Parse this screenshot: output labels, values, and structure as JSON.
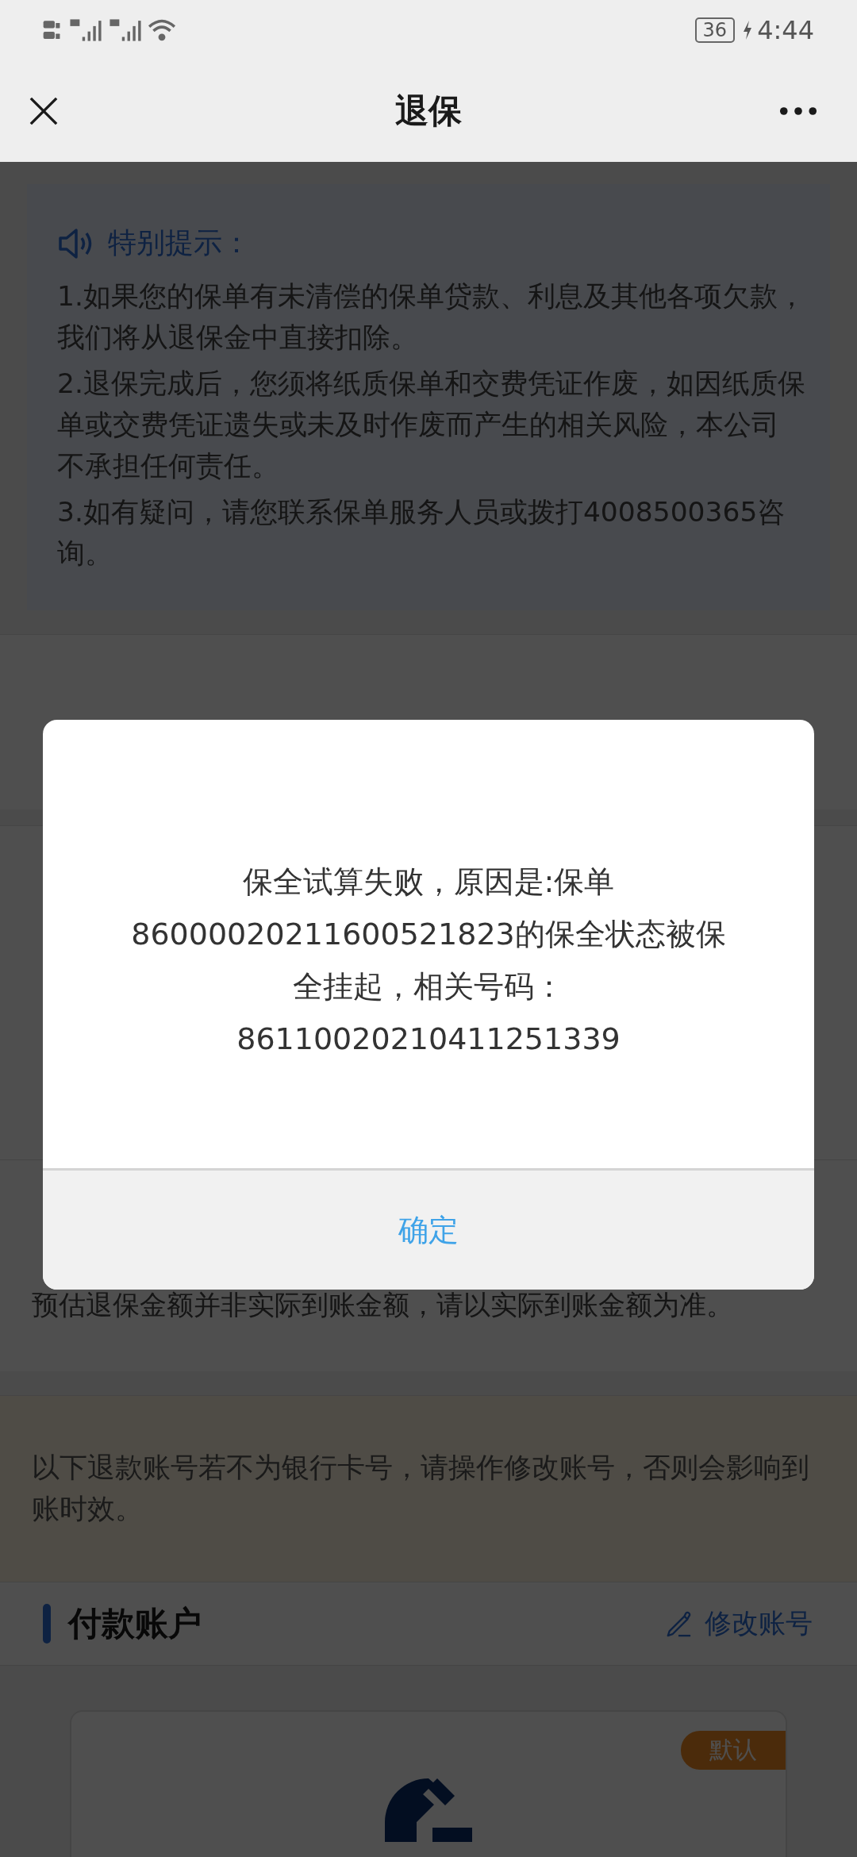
{
  "status_bar": {
    "battery": "36",
    "time": "4:44"
  },
  "header": {
    "title": "退保"
  },
  "notice": {
    "title": "特别提示：",
    "items": [
      "1.如果您的保单有未清偿的保单贷款、利息及其他各项欠款，我们将从退保金中直接扣除。",
      "2.退保完成后，您须将纸质保单和交费凭证作废，如因纸质保单或交费凭证遗失或未及时作废而产生的相关风险，本公司不承担任何责任。",
      "3.如有疑问，请您联系保单服务人员或拨打4008500365咨询。"
    ]
  },
  "estimate": {
    "note": "预估退保金额并非实际到账金额，请以实际到账金额为准。"
  },
  "banner": {
    "text": "以下退款账号若不为银行卡号，请操作修改账号，否则会影响到账时效。"
  },
  "account": {
    "title": "付款账户",
    "edit_label": "修改账号",
    "card": {
      "badge": "默认"
    }
  },
  "dialog": {
    "message_lines": [
      "保全试算失败，原因是:保单",
      "86000020211600521823的保全状态被保",
      "全挂起，相关号码：",
      "86110020210411251339"
    ],
    "button": "确定"
  }
}
